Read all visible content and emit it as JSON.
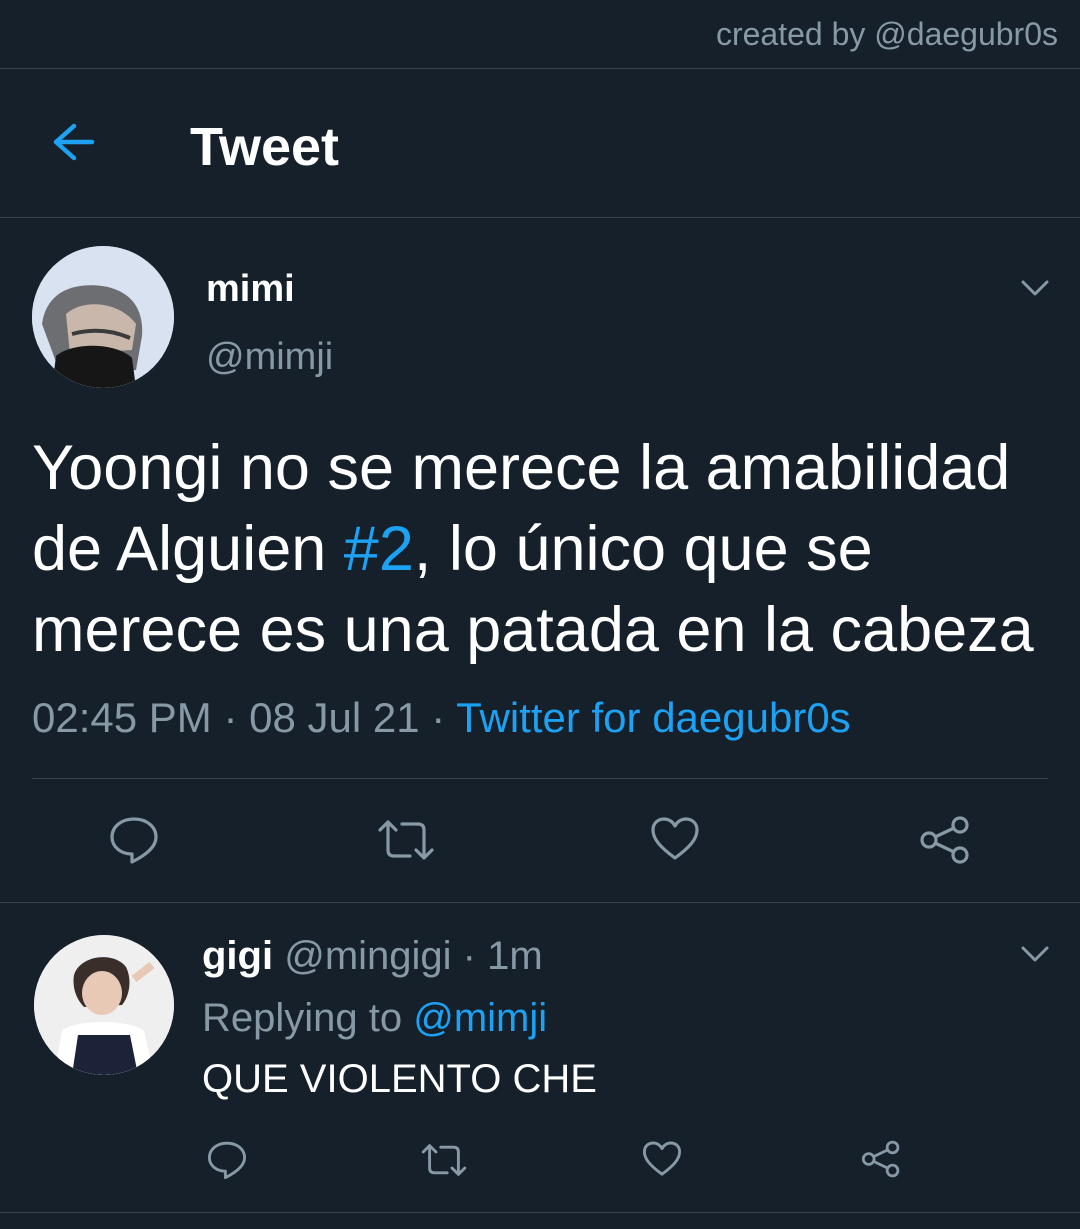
{
  "credit": "created by @daegubr0s",
  "header": {
    "title": "Tweet",
    "back_icon": "arrow-left-icon"
  },
  "tweet": {
    "name": "mimi",
    "handle": "@mimji",
    "text_before": "Yoongi no se merece la amabilidad de Alguien ",
    "hashtag": "#2",
    "text_after": ", lo único que se merece es una patada en la cabeza",
    "time": "02:45 PM",
    "sep1": " · ",
    "date": "08 Jul 21",
    "sep2": " · ",
    "source": "Twitter for daegubr0s",
    "actions": [
      "reply-icon",
      "retweet-icon",
      "like-icon",
      "share-icon"
    ]
  },
  "reply": {
    "name": "gigi",
    "handle": "@mingigi",
    "time": " · 1m",
    "replying_prefix": "Replying to ",
    "replying_to": "@mimji",
    "text": "QUE VIOLENTO CHE",
    "actions": [
      "reply-icon",
      "retweet-icon",
      "like-icon",
      "share-icon"
    ]
  },
  "colors": {
    "background": "#15202b",
    "accent": "#1da1f2",
    "muted": "#8899a6",
    "divider": "#38444d"
  }
}
